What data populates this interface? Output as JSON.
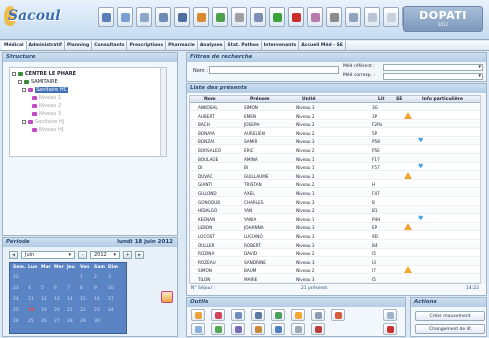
{
  "app": {
    "logo": "Sacoul",
    "brand_name": "DOPATI",
    "brand_year": "2012"
  },
  "toolbar_icons": [
    {
      "name": "edit-icon",
      "color": "#5a7fb5"
    },
    {
      "name": "pencil-icon",
      "color": "#7a9fd0"
    },
    {
      "name": "grid-icon",
      "color": "#8ea6c8"
    },
    {
      "name": "save-icon",
      "color": "#6d8bb4"
    },
    {
      "name": "home-icon",
      "color": "#4e6fa0"
    },
    {
      "name": "people-icon",
      "color": "#d78b2e"
    },
    {
      "name": "users-icon",
      "color": "#4e9f4e"
    },
    {
      "name": "brush-icon",
      "color": "#a0a0a0"
    },
    {
      "name": "stamp-icon",
      "color": "#7d8fb8"
    },
    {
      "name": "check-icon",
      "color": "#3aa33a"
    },
    {
      "name": "door-icon",
      "color": "#c9302c"
    },
    {
      "name": "image-icon",
      "color": "#b77aa8"
    },
    {
      "name": "archive-icon",
      "color": "#8a8a8a"
    },
    {
      "name": "chart-icon",
      "color": "#8fa3bd"
    },
    {
      "name": "docs-icon",
      "color": "#b8c4d3"
    },
    {
      "name": "page-icon",
      "color": "#c9d2dc"
    },
    {
      "name": "refresh-icon",
      "color": "#4ba64b"
    }
  ],
  "menu": [
    "Médical",
    "Administratif",
    "Planning",
    "Consultants",
    "Prescriptions",
    "Pharmacie",
    "Analyses",
    "Stat. Pathos",
    "Intervenants",
    "Accueil Méd - SE"
  ],
  "structure": {
    "title": "Structure",
    "tree": [
      {
        "label": "CENTRE LE PHARE",
        "level": 0,
        "color": "#3a8a3a"
      },
      {
        "label": "SAMITAIRE",
        "level": 1,
        "color": "#3a8a3a"
      },
      {
        "label": "Sanitaire HC",
        "level": 2,
        "color": "#c24bc4",
        "selected": true
      },
      {
        "label": "Niveau 1",
        "level": 3,
        "color": "#c24bc4"
      },
      {
        "label": "Niveau 2",
        "level": 3,
        "color": "#c24bc4"
      },
      {
        "label": "Niveau 3",
        "level": 3,
        "color": "#c24bc4"
      },
      {
        "label": "Sanitaire HJ",
        "level": 2,
        "color": "#c24bc4"
      },
      {
        "label": "Niveau HJ",
        "level": 3,
        "color": "#c24bc4"
      }
    ]
  },
  "period": {
    "title": "Période",
    "date": "lundi 18 juin 2012",
    "month": "Juin",
    "year": "2012",
    "day_headers": [
      "Sem.",
      "Lun",
      "Mar",
      "Mer",
      "Jeu",
      "Ven",
      "Sam",
      "Dim"
    ],
    "weeks": [
      {
        "week": "22",
        "days": [
          "",
          "",
          "",
          "",
          "1",
          "2",
          "3"
        ]
      },
      {
        "week": "23",
        "days": [
          "4",
          "5",
          "6",
          "7",
          "8",
          "9",
          "10"
        ]
      },
      {
        "week": "24",
        "days": [
          "11",
          "12",
          "13",
          "14",
          "15",
          "16",
          "17"
        ]
      },
      {
        "week": "25",
        "days": [
          "18",
          "19",
          "20",
          "21",
          "22",
          "23",
          "24"
        ]
      },
      {
        "week": "26",
        "days": [
          "25",
          "26",
          "27",
          "28",
          "29",
          "30",
          ""
        ]
      }
    ],
    "today": "18"
  },
  "search": {
    "title": "Filtres de recherche",
    "nom_label": "Nom :",
    "nom_value": "",
    "specialite_label": "Méd référent :",
    "convoque_label": "Méd corresp. :",
    "specialite_value": "",
    "convoque_value": ""
  },
  "list": {
    "title": "Liste des présents",
    "columns": [
      "Nom",
      "Prénom",
      "Unité",
      "Lit",
      "SE",
      "",
      "Info particulière"
    ],
    "rows": [
      [
        "ANKOSAL",
        "SIMON",
        "Niveau 3",
        "3G",
        "",
        "",
        ""
      ],
      [
        "AUBERT",
        "EMEN",
        "Niveau 2",
        "3P",
        "",
        "warn",
        ""
      ],
      [
        "BACH",
        "JOSEPH",
        "Niveau 2",
        "F2Pa",
        "",
        "",
        ""
      ],
      [
        "BONAYA",
        "AURELIEN",
        "Niveau 2",
        "5P",
        "",
        "",
        ""
      ],
      [
        "BONZAI",
        "SAMIR",
        "Niveau 3",
        "P58",
        "",
        "",
        "heart"
      ],
      [
        "BORSALEO",
        "ERIC",
        "Niveau 2",
        "P5E",
        "",
        "",
        ""
      ],
      [
        "BOULAGE",
        "AMINA",
        "Niveau 1",
        "F17",
        "",
        "",
        ""
      ],
      [
        "DI",
        "BI",
        "Niveau 1",
        "F57",
        "",
        "",
        "heart"
      ],
      [
        "DUVAC",
        "GUILLAUME",
        "Niveau 2",
        "",
        "",
        "warn",
        ""
      ],
      [
        "GIANTI",
        "TRISTAN",
        "Niveau 2",
        "H",
        "",
        "",
        ""
      ],
      [
        "GILLOND",
        "AXEL",
        "Niveau 1",
        "F47",
        "",
        "",
        ""
      ],
      [
        "GONODUB",
        "CHARLES",
        "Niveau 3",
        "B",
        "",
        "",
        ""
      ],
      [
        "HIDALGO",
        "YAN",
        "Niveau 2",
        "B1",
        "",
        "",
        ""
      ],
      [
        "KEENAN",
        "YANIA",
        "Niveau 1",
        "P4H",
        "",
        "",
        "heart"
      ],
      [
        "LEBON",
        "JOHANNA",
        "Niveau 3",
        "EP",
        "",
        "warn",
        ""
      ],
      [
        "LOCOST",
        "LUCIANO",
        "Niveau 3",
        "9D",
        "",
        "",
        ""
      ],
      [
        "OULLER",
        "ROBERT",
        "Niveau 3",
        "B4",
        "",
        "",
        ""
      ],
      [
        "ROZINA",
        "DAVID",
        "Niveau 2",
        "I5",
        "",
        "",
        ""
      ],
      [
        "ROZEAU",
        "SANDRINE",
        "Niveau 3",
        "I3",
        "",
        "",
        ""
      ],
      [
        "SIMON",
        "BAUM",
        "Niveau 2",
        "I7",
        "",
        "warn",
        ""
      ],
      [
        "TILON",
        "MARIE",
        "Niveau 3",
        "I5",
        "",
        "",
        ""
      ]
    ],
    "footer_label": "N° Séjour :",
    "footer_count": "21 présents",
    "footer_time": "14:22"
  },
  "outils": {
    "title": "Outils",
    "tools": [
      {
        "name": "scissors-icon",
        "color": "#e7a23c"
      },
      {
        "name": "pen-icon",
        "color": "#d1435b"
      },
      {
        "name": "stethoscope-icon",
        "color": "#6f8db6"
      },
      {
        "name": "printer-icon",
        "color": "#5c7a9e"
      },
      {
        "name": "calendar-icon",
        "color": "#4aa05a"
      },
      {
        "name": "alert-icon",
        "color": "#f0a531"
      },
      {
        "name": "network-icon",
        "color": "#8e9cb3"
      },
      {
        "name": "mail-icon",
        "color": "#d65b3a"
      },
      {
        "name": "folder-icon",
        "color": "#8ab0d8"
      },
      {
        "name": "chart-green-icon",
        "color": "#52a852"
      },
      {
        "name": "book-icon",
        "color": "#7c6cb5"
      },
      {
        "name": "clipboard-icon",
        "color": "#c88a3a"
      },
      {
        "name": "user-card-icon",
        "color": "#4f7fc0"
      },
      {
        "name": "settings-icon",
        "color": "#9ca8b8"
      },
      {
        "name": "pill-icon",
        "color": "#bf3f3f"
      }
    ]
  },
  "actions": {
    "title": "Actions",
    "buttons": [
      "Créer mouvement",
      "Changement de lit"
    ]
  }
}
